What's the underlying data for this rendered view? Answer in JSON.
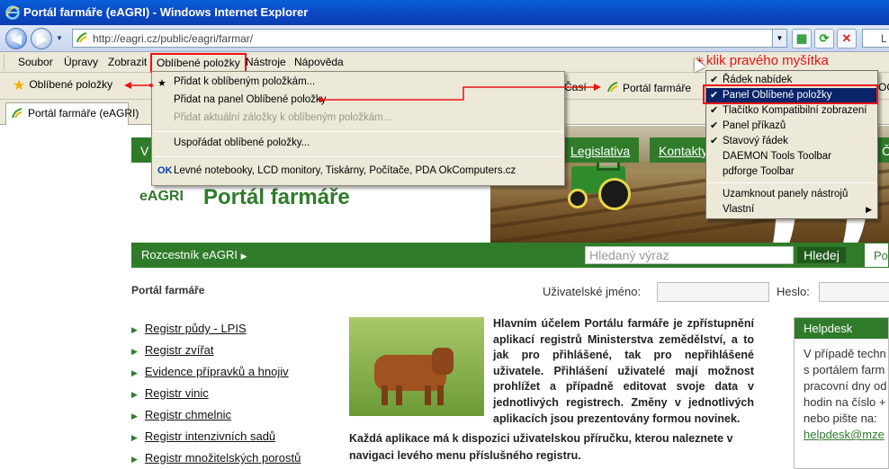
{
  "window": {
    "title": "Portál farmáře (eAGRI) - Windows Internet Explorer"
  },
  "address": {
    "url": "http://eagri.cz/public/eagri/farmar/",
    "search_partial": "L"
  },
  "menubar": [
    "Soubor",
    "Úpravy",
    "Zobrazit",
    "Oblíbené položky",
    "Nástroje",
    "Nápověda"
  ],
  "favbar": {
    "button": "Oblíbené položky",
    "links": [
      "Časí",
      "Portál farmáře",
      "OG"
    ]
  },
  "tab": {
    "title": "Portál farmáře (eAGRI)"
  },
  "favorites_menu": {
    "items": [
      {
        "label": "Přidat k oblíbeným položkám...",
        "enabled": true
      },
      {
        "label": "Přidat na panel Oblíbené položky",
        "enabled": true
      },
      {
        "label": "Přidat aktuální záložky k oblíbeným položkám...",
        "enabled": false
      },
      {
        "label": "Uspořádat oblíbené položky...",
        "enabled": true
      },
      {
        "label": "Levné notebooky, LCD monitory, Tiskárny, Počítače, PDA  OkComputers.cz",
        "enabled": true
      }
    ]
  },
  "annotation": {
    "text": "klik pravého myšítka"
  },
  "context_menu": {
    "items": [
      {
        "label": "Řádek nabídek",
        "checked": true
      },
      {
        "label": "Panel Oblíbené položky",
        "checked": true,
        "highlighted": true
      },
      {
        "label": "Tlačítko Kompatibilní zobrazení",
        "checked": true
      },
      {
        "label": "Panel příkazů",
        "checked": true
      },
      {
        "label": "Stavový řádek",
        "checked": true
      },
      {
        "label": "DAEMON Tools Toolbar",
        "checked": false
      },
      {
        "label": "pdforge Toolbar",
        "checked": false
      },
      {
        "label": "Uzamknout panely nástrojů",
        "checked": false
      },
      {
        "label": "Vlastní",
        "checked": false,
        "submenu": true
      }
    ]
  },
  "site": {
    "nav_left": "V",
    "nav": [
      "Legislativa",
      "Kontakty",
      "Č"
    ],
    "brand": "eAGRI",
    "title": "Portál farmáře",
    "rozcestnik": "Rozcestník eAGRI",
    "search_placeholder": "Hledaný výraz",
    "search_button": "Hledej",
    "po": "Po",
    "page_heading": "Portál farmáře",
    "login": {
      "username_label": "Uživatelské jméno:",
      "password_label": "Heslo:"
    },
    "registries": [
      "Registr půdy - LPIS",
      "Registr zvířat",
      "Evidence přípravků a hnojiv",
      "Registr vinic",
      "Registr chmelnic",
      "Registr intenzivních sadů",
      "Registr množitelských porostů"
    ],
    "intro": "Hlavním účelem Portálu farmáře je zpřístupnění aplikací registrů Ministerstva zemědělství, a to jak pro přihlášené, tak pro nepřihlášené uživatele. Přihlášení uživatelé mají možnost prohlížet a případně editovat svoje data v jednotlivých registrech. Změny v jednotlivých aplikacích jsou prezentovány formou novinek.",
    "intro2": "Každá aplikace má k dispozici uživatelskou příručku, kterou naleznete v navigaci levého menu příslušného registru.",
    "helpdesk": {
      "title": "Helpdesk",
      "lines": [
        "V případě techn",
        "s portálem farm",
        "pracovní dny od",
        "hodin na číslo +",
        "nebo pište na:"
      ],
      "email": "helpdesk@mze"
    }
  },
  "colors": {
    "accent_green": "#2f7b2a",
    "annotation_red": "#e11111",
    "menu_bg": "#ece9d8",
    "highlight": "#0a246a"
  }
}
